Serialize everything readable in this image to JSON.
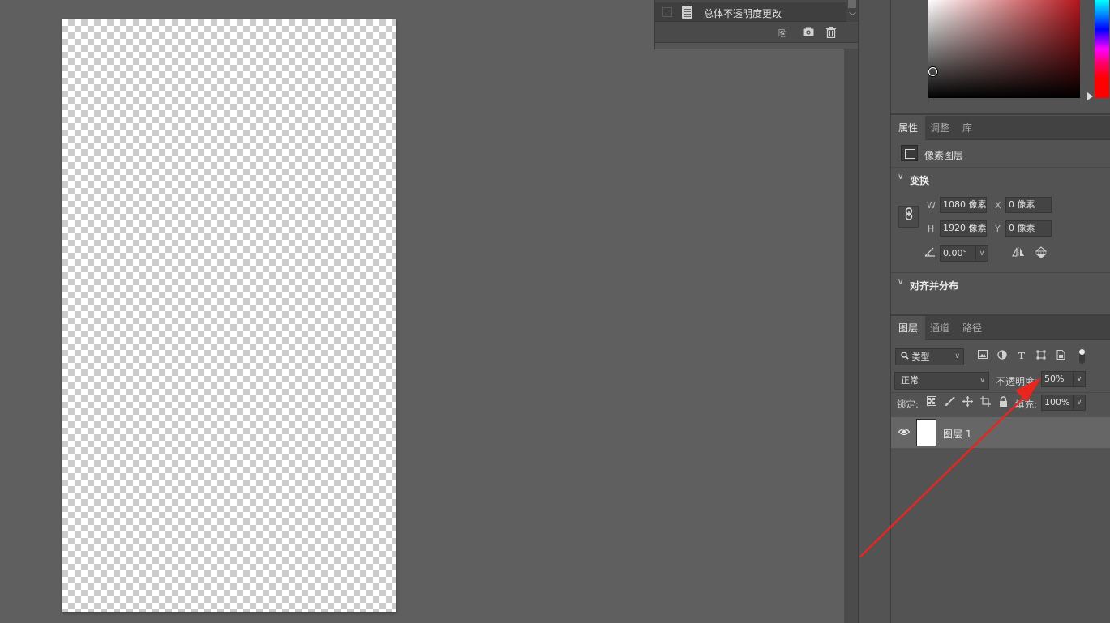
{
  "history": {
    "item_label": "总体不透明度更改",
    "buttons": {
      "new_doc": "⎘",
      "snapshot": "📷",
      "delete": "🗑"
    }
  },
  "properties_tabs": [
    {
      "label": "属性",
      "active": true
    },
    {
      "label": "调整",
      "active": false
    },
    {
      "label": "库",
      "active": false
    }
  ],
  "properties": {
    "layer_type": "像素图层",
    "transform": {
      "title": "变换",
      "w_label": "W",
      "w_value": "1080 像素",
      "h_label": "H",
      "h_value": "1920 像素",
      "x_label": "X",
      "x_value": "0 像素",
      "y_label": "Y",
      "y_value": "0 像素",
      "angle_value": "0.00°"
    },
    "align_title": "对齐并分布"
  },
  "layers_tabs": [
    {
      "label": "图层",
      "active": true
    },
    {
      "label": "通道",
      "active": false
    },
    {
      "label": "路径",
      "active": false
    }
  ],
  "layers": {
    "filter_value": "类型",
    "blend_mode": "正常",
    "opacity_label": "不透明度:",
    "opacity_value": "50%",
    "lock_label": "锁定:",
    "fill_label": "填充:",
    "fill_value": "100%",
    "items": [
      {
        "name": "图层 1",
        "visible": true
      }
    ]
  },
  "colors": {
    "hue_base": "#b3151b",
    "annotation_arrow": "#e8261e",
    "selected_layer_bg": "#666666"
  }
}
